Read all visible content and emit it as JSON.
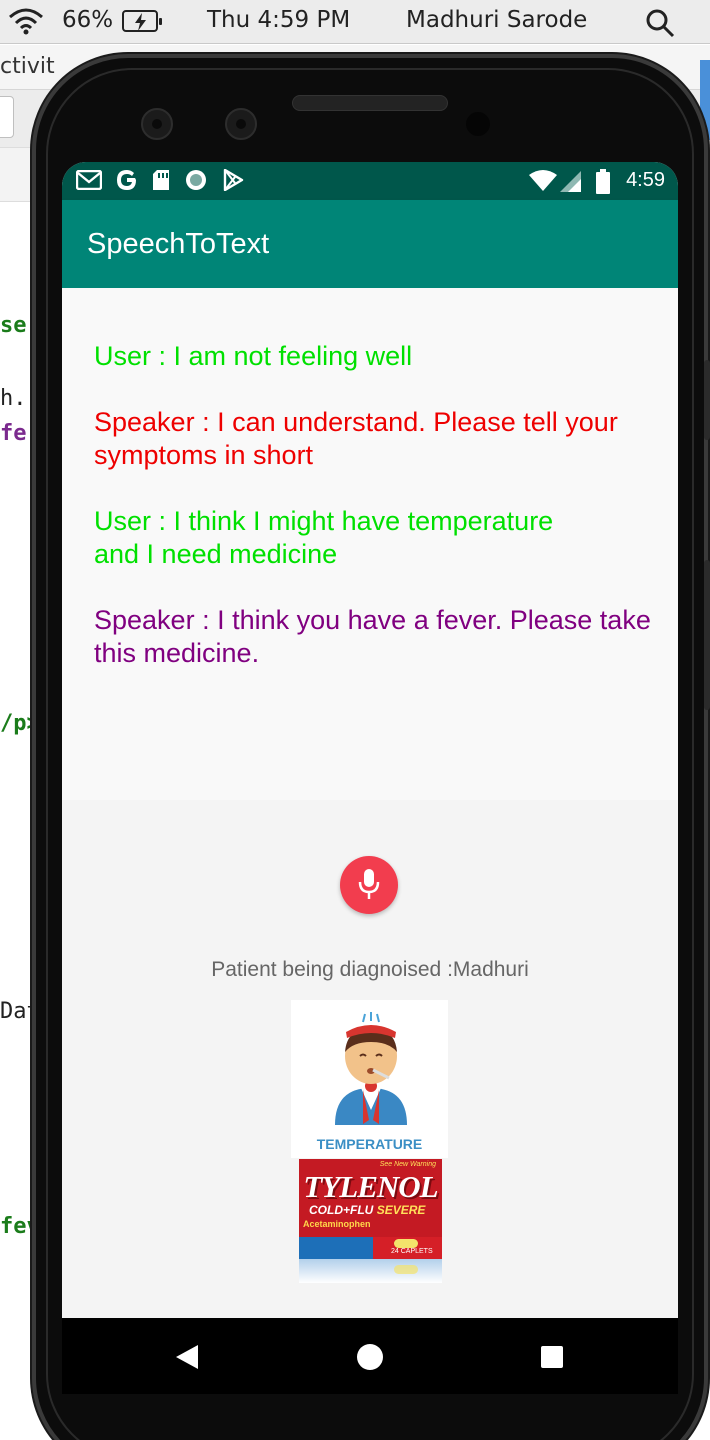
{
  "mac_menubar": {
    "battery_percent": "66%",
    "clock": "Thu 4:59 PM",
    "user": "Madhuri Sarode",
    "icons": [
      "wifi-icon",
      "battery-charging-icon",
      "spotlight-search-icon"
    ]
  },
  "ide_background": {
    "tab_fragment": "ctivit",
    "code_fragments": [
      "se",
      "h.",
      "fe",
      "/p>",
      "Dat",
      "fev"
    ]
  },
  "android_status": {
    "time": "4:59",
    "left_icons": [
      "gmail-icon",
      "google-icon",
      "sd-card-icon",
      "circle-notification-icon",
      "play-store-icon"
    ],
    "right_icons": [
      "wifi-icon",
      "signal-icon",
      "battery-icon"
    ]
  },
  "app": {
    "title": "SpeechToText",
    "messages": [
      {
        "text": "User : I am not feeling well",
        "color": "#00e000"
      },
      {
        "text": "Speaker : I can understand. Please tell your symptoms in short",
        "color": "#ee0000"
      },
      {
        "text": "User : I think I might have temperature and I need medicine",
        "color": "#00e000"
      },
      {
        "text": "Speaker : I think you have a fever. Please take this medicine.",
        "color": "#800080"
      }
    ],
    "mic_button_icon": "microphone-icon",
    "patient_label": "Patient being diagnoised :Madhuri",
    "symptom_image": {
      "caption": "TEMPERATURE"
    },
    "medicine_image": {
      "brand": "TYLENOL",
      "subtitle_prefix": "COLD+FLU",
      "subtitle_emph": "SEVERE",
      "note": "See New Warning",
      "ingredient": "Acetaminophen",
      "count": "24 CAPLETS"
    }
  },
  "android_nav": {
    "icons": [
      "back-icon",
      "home-icon",
      "recents-icon"
    ]
  },
  "colors": {
    "app_bar": "#008577",
    "status_bar": "#00574b",
    "mic_button": "#f23d4e"
  }
}
